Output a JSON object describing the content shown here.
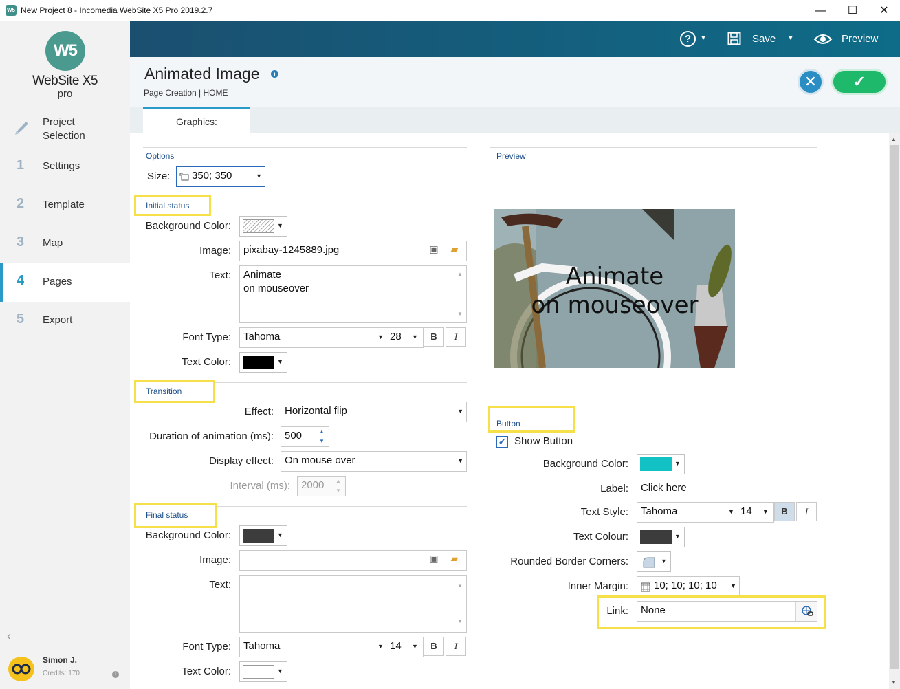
{
  "window": {
    "title": "New Project 8 - Incomedia WebSite X5 Pro 2019.2.7",
    "app_icon": "W5",
    "minimize": "—",
    "maximize": "☐",
    "close": "✕"
  },
  "sidebar": {
    "logo_mark": "W5",
    "logo_name": "WebSite X5",
    "logo_pro": "pro",
    "items": [
      {
        "num": "",
        "label": "Project Selection",
        "icon": "rocket-icon"
      },
      {
        "num": "1",
        "label": "Settings"
      },
      {
        "num": "2",
        "label": "Template"
      },
      {
        "num": "3",
        "label": "Map"
      },
      {
        "num": "4",
        "label": "Pages"
      },
      {
        "num": "5",
        "label": "Export"
      }
    ],
    "collapse": "‹",
    "user": {
      "name": "Simon J.",
      "credits": "Credits: 170"
    }
  },
  "toolbar": {
    "help": "?",
    "save": "Save",
    "preview": "Preview"
  },
  "header": {
    "title": "Animated Image",
    "breadcrumb": "Page Creation | HOME"
  },
  "tabs": [
    {
      "label": "Graphics:"
    }
  ],
  "options": {
    "heading": "Options",
    "size_label": "Size:",
    "size_value": "350; 350"
  },
  "initial": {
    "heading": "Initial status",
    "bg_label": "Background Color:",
    "image_label": "Image:",
    "image_value": "pixabay-1245889.jpg",
    "text_label": "Text:",
    "text_line1": "Animate",
    "text_line2": "on mouseover",
    "font_label": "Font Type:",
    "font_value": "Tahoma",
    "font_size": "28",
    "bold": "B",
    "italic": "I",
    "text_color_label": "Text Color:",
    "text_color": "#000000"
  },
  "transition": {
    "heading": "Transition",
    "effect_label": "Effect:",
    "effect_value": "Horizontal flip",
    "duration_label": "Duration of animation (ms):",
    "duration_value": "500",
    "display_label": "Display effect:",
    "display_value": "On mouse over",
    "interval_label": "Interval (ms):",
    "interval_value": "2000"
  },
  "final": {
    "heading": "Final status",
    "bg_label": "Background Color:",
    "bg_color": "#3c3c3c",
    "image_label": "Image:",
    "image_value": "",
    "text_label": "Text:",
    "font_label": "Font Type:",
    "font_value": "Tahoma",
    "font_size": "14",
    "bold": "B",
    "italic": "I",
    "text_color_label": "Text Color:",
    "text_color": "#ffffff"
  },
  "preview": {
    "heading": "Preview",
    "line1": "Animate",
    "line2": "on mouseover"
  },
  "button": {
    "heading": "Button",
    "show_label": "Show Button",
    "show_checked": true,
    "bg_label": "Background Color:",
    "bg_color": "#12c1c4",
    "label_label": "Label:",
    "label_value": "Click here",
    "style_label": "Text Style:",
    "style_font": "Tahoma",
    "style_size": "14",
    "bold": "B",
    "italic": "I",
    "colour_label": "Text Colour:",
    "colour_value": "#3c3c3c",
    "corners_label": "Rounded Border Corners:",
    "margin_label": "Inner Margin:",
    "margin_value": "10; 10; 10; 10",
    "link_label": "Link:",
    "link_value": "None"
  }
}
